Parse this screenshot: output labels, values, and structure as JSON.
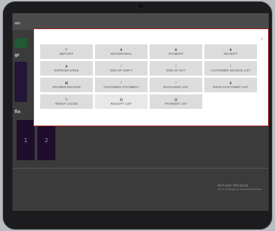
{
  "background_app": {
    "header_title": "abc",
    "section_label_1": "gr",
    "section_label_2": "fin",
    "tiles": [
      "1",
      "2"
    ],
    "watermark": {
      "line1": "Activate Windows",
      "line2": "Go to Settings to activate Windows."
    }
  },
  "modal": {
    "close_label": "×",
    "buttons": [
      {
        "label": "DEPOSIT",
        "icon": "↻",
        "icon_name": "refresh-icon"
      },
      {
        "label": "WITHDRAWAL",
        "icon": "♟",
        "icon_name": "user-icon"
      },
      {
        "label": "PAYMENT",
        "icon": "♟",
        "icon_name": "user-icon"
      },
      {
        "label": "RECEIPT",
        "icon": "♟",
        "icon_name": "user-icon"
      },
      {
        "label": "EXPENDITURES",
        "icon": "♟",
        "icon_name": "user-icon"
      },
      {
        "label": "END OF SHIFT",
        "icon": "ⵑ",
        "icon_name": "pin-icon"
      },
      {
        "label": "END OF DAY",
        "icon": "ⵑ",
        "icon_name": "pin-icon"
      },
      {
        "label": "CUSTOMER INVOICE LIST",
        "icon": "ⵑ",
        "icon_name": "pin-icon"
      },
      {
        "label": "DRAWER REASON",
        "icon": "▦",
        "icon_name": "drawer-icon"
      },
      {
        "label": "CUSTOMER STATMENT",
        "icon": "ⵑ",
        "icon_name": "pin-icon"
      },
      {
        "label": "EXCHANGE LIST",
        "icon": "ⵑ",
        "icon_name": "pin-icon"
      },
      {
        "label": "ROAD CUSTOMER LIST",
        "icon": "♟",
        "icon_name": "user-icon"
      },
      {
        "label": "RESET CACHE",
        "icon": "↻",
        "icon_name": "refresh-icon"
      },
      {
        "label": "RECEIPT LIST",
        "icon": "▤",
        "icon_name": "list-icon"
      },
      {
        "label": "PAYMENT LIST",
        "icon": "▤",
        "icon_name": "list-icon"
      }
    ]
  }
}
